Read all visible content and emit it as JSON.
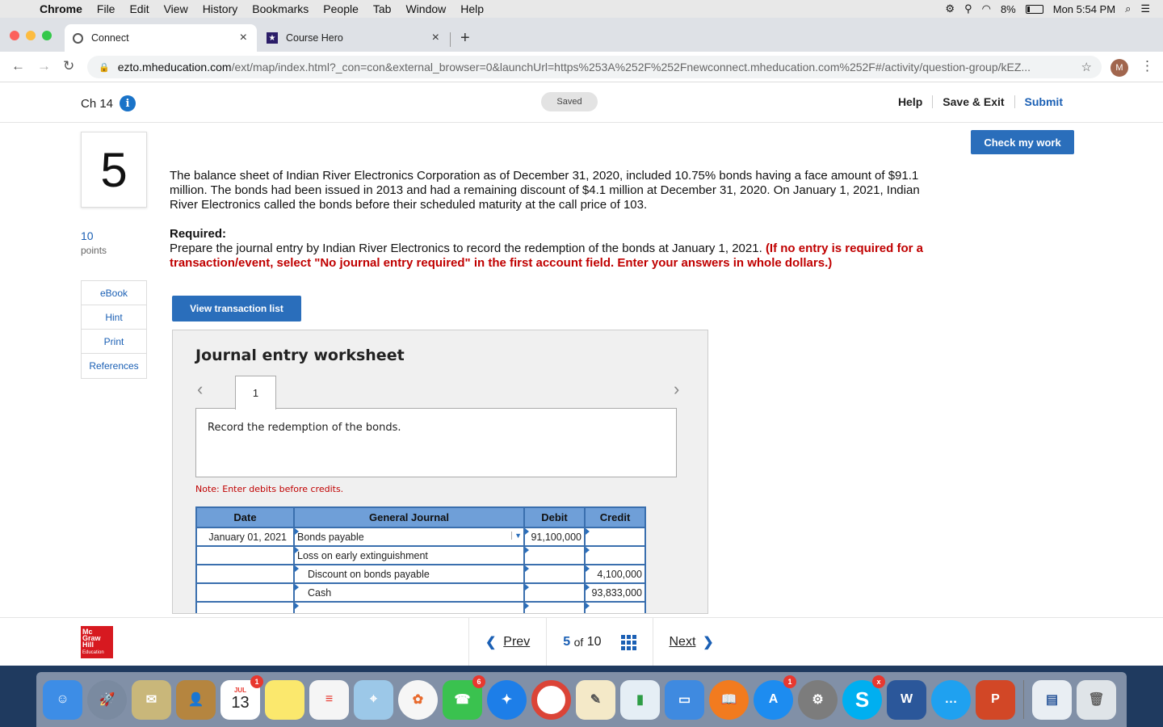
{
  "menubar": {
    "app": "Chrome",
    "items": [
      "File",
      "Edit",
      "View",
      "History",
      "Bookmarks",
      "People",
      "Tab",
      "Window",
      "Help"
    ],
    "battery": "8%",
    "clock": "Mon 5:54 PM"
  },
  "tabs": [
    {
      "label": "Connect",
      "close": "×"
    },
    {
      "label": "Course Hero",
      "close": "×"
    }
  ],
  "address": {
    "host": "ezto.mheducation.com",
    "path": "/ext/map/index.html?_con=con&external_browser=0&launchUrl=https%253A%252F%252Fnewconnect.mheducation.com%252F#/activity/question-group/kEZ...",
    "avatar": "M"
  },
  "header": {
    "chapter": "Ch 14",
    "info": "i",
    "status": "Saved",
    "help": "Help",
    "save_exit": "Save & Exit",
    "submit": "Submit"
  },
  "question": {
    "number": "5",
    "points": "10",
    "points_label": "points",
    "text": "The balance sheet of Indian River Electronics Corporation as of December 31, 2020, included 10.75% bonds having a face amount of $91.1 million. The bonds had been issued in 2013 and had a remaining discount of $4.1 million at December 31, 2020. On January 1, 2021, Indian River Electronics called the bonds before their scheduled maturity at the call price of 103.",
    "required_heading": "Required:",
    "required_text": "Prepare the journal entry by Indian River Electronics to record the redemption of the bonds at January 1, 2021. ",
    "required_red": "(If no entry is required for a transaction/event, select \"No journal entry required\" in the first account field. Enter your answers in whole dollars.)"
  },
  "tools": [
    "eBook",
    "Hint",
    "Print",
    "References"
  ],
  "buttons": {
    "check_work": "Check my work",
    "view_transactions": "View transaction list"
  },
  "worksheet": {
    "title": "Journal entry worksheet",
    "tab": "1",
    "instruction": "Record the redemption of the bonds.",
    "note": "Note: Enter debits before credits.",
    "headers": [
      "Date",
      "General Journal",
      "Debit",
      "Credit"
    ],
    "rows": [
      {
        "date": "January 01, 2021",
        "account": "Bonds payable",
        "debit": "91,100,000",
        "credit": ""
      },
      {
        "date": "",
        "account": "Loss on early extinguishment",
        "debit": "",
        "credit": ""
      },
      {
        "date": "",
        "account": "Discount on bonds payable",
        "debit": "",
        "credit": "4,100,000"
      },
      {
        "date": "",
        "account": "Cash",
        "debit": "",
        "credit": "93,833,000"
      },
      {
        "date": "",
        "account": "",
        "debit": "",
        "credit": ""
      }
    ]
  },
  "pager": {
    "prev": "Prev",
    "current": "5",
    "of": "of",
    "total": "10",
    "next": "Next"
  },
  "logo": {
    "line1": "Mc",
    "line2": "Graw",
    "line3": "Hill",
    "line4": "Education"
  },
  "dock": {
    "calendar_month": "JUL",
    "calendar_day": "13",
    "badges": {
      "calendar": "1",
      "facetime": "6",
      "appstore": "1",
      "skype": "x"
    }
  }
}
